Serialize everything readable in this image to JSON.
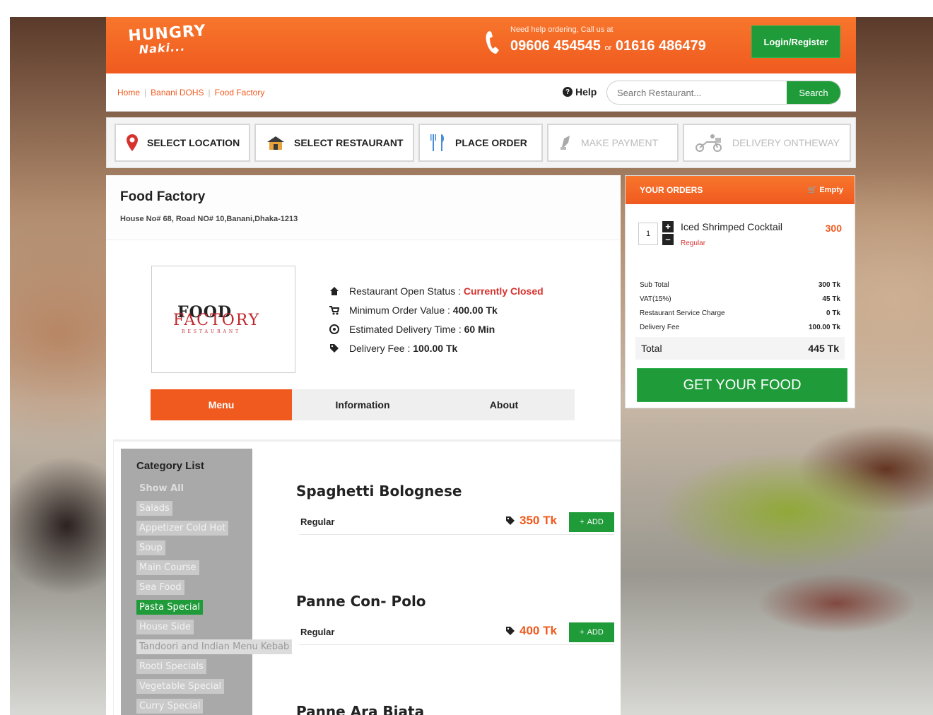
{
  "brand": {
    "logo_line1": "HUNGRY",
    "logo_line2": "Naki..."
  },
  "header": {
    "help_note": "Need help ordering, Call us at",
    "phone1": "09606 454545",
    "or": "or",
    "phone2": "01616 486479",
    "login_label": "Login/Register",
    "phone_icon": "phone-icon"
  },
  "breadcrumb": [
    "Home",
    "Banani DOHS",
    "Food Factory"
  ],
  "help_label": "Help",
  "search": {
    "placeholder": "Search Restaurant...",
    "button_label": "Search"
  },
  "steps": [
    {
      "label": "SELECT LOCATION",
      "icon": "map-pin-icon",
      "active": true
    },
    {
      "label": "SELECT RESTAURANT",
      "icon": "restaurant-icon",
      "active": true
    },
    {
      "label": "PLACE ORDER",
      "icon": "cutlery-icon",
      "active": true
    },
    {
      "label": "MAKE PAYMENT",
      "icon": "payment-icon",
      "active": false
    },
    {
      "label": "DELIVERY ONTHEWAY",
      "icon": "scooter-icon",
      "active": false
    }
  ],
  "restaurant": {
    "name": "Food Factory",
    "address": "House No# 68, Road NO# 10,Banani,Dhaka-1213",
    "logo_text": {
      "line1": "FOOD",
      "line2": "FACTORY",
      "line3": "RESTAURANT"
    },
    "status_label": "Restaurant Open Status :",
    "status_value": "Currently Closed",
    "min_order_label": "Minimum Order Value :",
    "min_order_value": "400.00 Tk",
    "delivery_time_label": "Estimated Delivery Time :",
    "delivery_time_value": "60 Min",
    "delivery_fee_label": "Delivery Fee :",
    "delivery_fee_value": "100.00 Tk"
  },
  "tabs": [
    "Menu",
    "Information",
    "About"
  ],
  "category_list": {
    "title": "Category List",
    "items": [
      "Show All",
      "Salads",
      "Appetizer Cold Hot",
      "Soup",
      "Main Course",
      "Sea Food",
      "Pasta Special",
      "House Side",
      "Tandoori and Indian Menu Kebab",
      "Rooti Specials",
      "Vegetable Special",
      "Curry Special"
    ],
    "active": "Pasta Special"
  },
  "menu_items": [
    {
      "name": "Spaghetti Bolognese",
      "variant": "Regular",
      "price": "350 Tk",
      "add_label": "ADD"
    },
    {
      "name": "Panne Con- Polo",
      "variant": "Regular",
      "price": "400 Tk",
      "add_label": "ADD"
    },
    {
      "name": "Panne Ara Biata"
    }
  ],
  "orders": {
    "title": "YOUR ORDERS",
    "empty_label": "Empty",
    "item": {
      "qty": "1",
      "name": "Iced Shrimped Cocktail",
      "variant": "Regular",
      "price": "300"
    },
    "sub_total_label": "Sub Total",
    "sub_total": "300 Tk",
    "vat_label": "VAT(15%)",
    "vat": "45 Tk",
    "service_label": "Restaurant Service Charge",
    "service": "0 Tk",
    "delivery_label": "Delivery Fee",
    "delivery": "100.00 Tk",
    "total_label": "Total",
    "total": "445 Tk",
    "cta_label": "GET YOUR FOOD"
  },
  "colors": {
    "accent": "#f05a1f",
    "green": "#1f9b3a",
    "closed": "#d6322e"
  }
}
